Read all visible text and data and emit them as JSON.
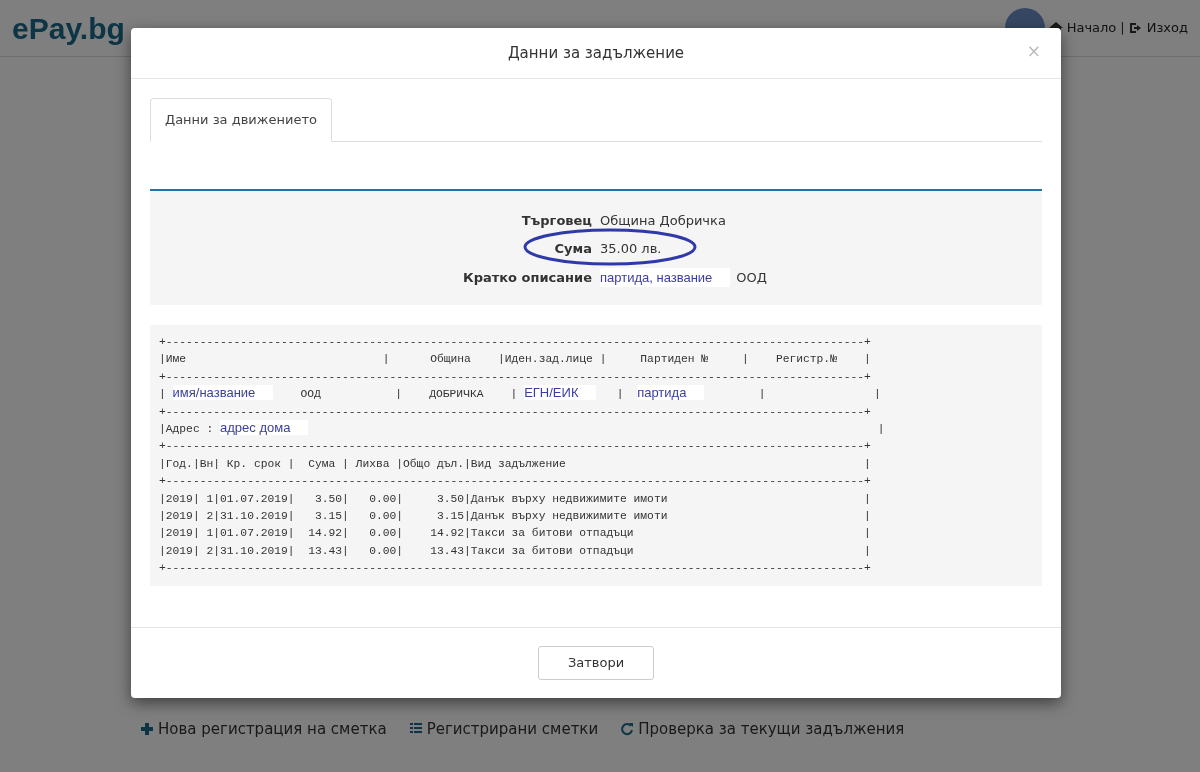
{
  "header": {
    "logo": "ePay.bg",
    "links": [
      {
        "kind": "home",
        "label": "Начало"
      },
      {
        "kind": "exit",
        "label": "Изход"
      }
    ],
    "separator": "|"
  },
  "bottom_links": [
    {
      "kind": "plus",
      "label": "Нова регистрация на сметка"
    },
    {
      "kind": "list",
      "label": "Регистрирани сметки"
    },
    {
      "kind": "refresh",
      "label": "Проверка за текущи задължения"
    }
  ],
  "modal": {
    "title": "Данни за задължение",
    "close": "×",
    "tabs": [
      {
        "label": "Данни за движението",
        "selected": true
      }
    ],
    "details": [
      {
        "label": "Търговец",
        "value": [
          {
            "kind": "text",
            "text": "Община Добричка"
          }
        ],
        "circled": false
      },
      {
        "label": "Сума",
        "value": [
          {
            "kind": "text",
            "text": "35.00 лв."
          }
        ],
        "circled": true
      },
      {
        "label": "Кратко описание",
        "value": [
          {
            "kind": "note",
            "text": "партида, название"
          },
          {
            "kind": "text",
            "text": "ООД"
          }
        ],
        "circled": false
      }
    ],
    "report": [
      [
        {
          "kind": "mono",
          "text": "+-------------------------------------------------------------------------------------------------------+"
        }
      ],
      [
        {
          "kind": "mono",
          "text": "|Име                             |      Община    |Иден.зад.лице |     Партиден №     |    Регистр.№    |"
        }
      ],
      [
        {
          "kind": "mono",
          "text": "+-------------------------------------------------------------------------------------------------------+"
        }
      ],
      [
        {
          "kind": "mono",
          "text": "| "
        },
        {
          "kind": "note",
          "text": "имя/название"
        },
        {
          "kind": "mono",
          "text": "    ООД           |    ДОБРИЧКА    | "
        },
        {
          "kind": "note",
          "text": "ЕГН/ЕИК"
        },
        {
          "kind": "mono",
          "text": "   |  "
        },
        {
          "kind": "note",
          "text": "партида"
        },
        {
          "kind": "mono",
          "text": "        |                |"
        }
      ],
      [
        {
          "kind": "mono",
          "text": "+-------------------------------------------------------------------------------------------------------+"
        }
      ],
      [
        {
          "kind": "mono",
          "text": "|Адрес : "
        },
        {
          "kind": "note",
          "text": "адрес дома"
        },
        {
          "kind": "mono",
          "text": "                                                                                    |"
        }
      ],
      [
        {
          "kind": "mono",
          "text": "+-------------------------------------------------------------------------------------------------------+"
        }
      ],
      [
        {
          "kind": "mono",
          "text": "|Год.|Вн| Кр. срок |  Сума | Лихва |Общо дъл.|Вид задължение                                            |"
        }
      ],
      [
        {
          "kind": "mono",
          "text": "+-------------------------------------------------------------------------------------------------------+"
        }
      ],
      [
        {
          "kind": "mono",
          "text": "|2019| 1|01.07.2019|   3.50|   0.00|     3.50|Данък върху недвижимите имоти                             |"
        }
      ],
      [
        {
          "kind": "mono",
          "text": "|2019| 2|31.10.2019|   3.15|   0.00|     3.15|Данък върху недвижимите имоти                             |"
        }
      ],
      [
        {
          "kind": "mono",
          "text": "|2019| 1|01.07.2019|  14.92|   0.00|    14.92|Такси за битови отпадъци                                  |"
        }
      ],
      [
        {
          "kind": "mono",
          "text": "|2019| 2|31.10.2019|  13.43|   0.00|    13.43|Такси за битови отпадъци                                  |"
        }
      ],
      [
        {
          "kind": "mono",
          "text": "+-------------------------------------------------------------------------------------------------------+"
        }
      ]
    ],
    "close_button": "Затвори"
  }
}
